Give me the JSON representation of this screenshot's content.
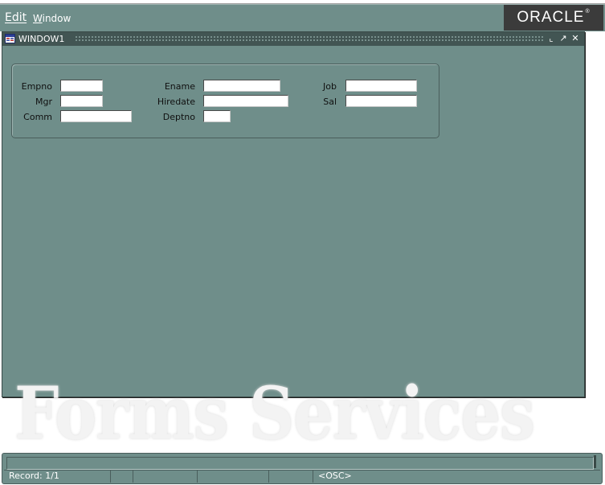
{
  "menu": {
    "edit": "Edit",
    "window_first": "W",
    "window_rest": "indow"
  },
  "brand": {
    "logo_text": "ORACLE"
  },
  "window": {
    "title": "WINDOW1",
    "minimize_glyph": "⌞",
    "maximize_glyph": "↗",
    "close_glyph": "✕"
  },
  "form": {
    "fields": {
      "empno": {
        "label": "Empno",
        "value": ""
      },
      "ename": {
        "label": "Ename",
        "value": ""
      },
      "job": {
        "label": "Job",
        "value": ""
      },
      "mgr": {
        "label": "Mgr",
        "value": ""
      },
      "hiredate": {
        "label": "Hiredate",
        "value": ""
      },
      "sal": {
        "label": "Sal",
        "value": ""
      },
      "comm": {
        "label": "Comm",
        "value": ""
      },
      "deptno": {
        "label": "Deptno",
        "value": ""
      }
    }
  },
  "watermark": {
    "text": "Forms Services"
  },
  "status": {
    "message": "",
    "record": "Record: 1/1",
    "osc": "<OSC>"
  },
  "colors": {
    "canvas": "#6f8e8a",
    "titlebar": "#425553",
    "logo_bg": "#3b3b3b"
  },
  "icons": {
    "window_icon": "forms-window-icon",
    "minimize": "minimize-icon",
    "maximize": "maximize-icon",
    "close": "close-icon"
  }
}
